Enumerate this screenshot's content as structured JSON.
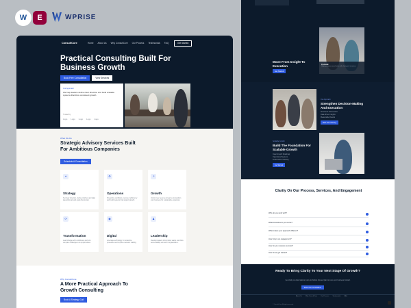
{
  "brand": {
    "logo_text": "WPRISE",
    "badge_wp": "W",
    "badge_el": "E"
  },
  "left": {
    "nav": {
      "brand": "ConsultCore",
      "items": [
        "Home",
        "About Us",
        "Why ConsultCore",
        "Our Process",
        "Testimonials",
        "FAQ"
      ],
      "cta": "Get Started"
    },
    "hero": {
      "title": "Practical Consulting Built For Business Growth",
      "subtitle": "We help leaders define clear direction and build scalable systems that drive consistent growth.",
      "btn_primary": "Book Free Consultation",
      "btn_secondary": "View Services",
      "card_label": "Our Approach",
      "card_text": "We help leaders define clear direction and build scalable systems that drive consistent growth.",
      "trusted": "Trusted by",
      "logos": [
        "Logo",
        "Logo",
        "Logo",
        "Logo",
        "Logo"
      ]
    },
    "services": {
      "eyebrow": "What We Do",
      "title": "Strategic Advisory Services Built For Ambitious Companies",
      "cta": "Schedule A Consultation",
      "cards": [
        {
          "title": "Strategy",
          "desc": "Set clear direction, define priorities and align leadership around goals that matter."
        },
        {
          "title": "Operations",
          "desc": "Streamline workflows, remove inefficiency and build systems that support growth."
        },
        {
          "title": "Growth",
          "desc": "Unlock new revenue streams and position your business for sustainable expansion."
        },
        {
          "title": "Transformation",
          "desc": "Lead change with confidence and turn complex challenges into opportunities."
        },
        {
          "title": "Digital",
          "desc": "Leverage technology to modernize processes and improve decision making."
        },
        {
          "title": "Leadership",
          "desc": "Develop leaders who inspire teams and drive accountability across the organization."
        }
      ]
    },
    "approach": {
      "eyebrow": "Why ConsultCore",
      "title": "A More Practical Approach To Growth Consulting",
      "cta": "Book A Strategy Call"
    }
  },
  "right": {
    "block1": {
      "title": "Move From Insight To Execution",
      "cta": "Get Started"
    },
    "caption": {
      "title": "Consult",
      "text": "Helping teams move faster with clarity and structure."
    },
    "block2": {
      "eyebrow": "Our Approach",
      "title": "Strengthen Decision-Making And Execution",
      "points": [
        "Structured Frameworks",
        "Data-Driven Insights",
        "Measurable Results"
      ],
      "cta": "Start Your Journey"
    },
    "block3": {
      "eyebrow": "Scalable Growth",
      "title": "Build The Foundation For Scalable Growth",
      "points": [
        "Clear Growth Roadmap",
        "Operational Systems",
        "Performance Tracking"
      ],
      "cta": "Get Started"
    },
    "faq": {
      "title": "Clarity On Our Process, Services, And Engagement",
      "questions": [
        "Who do you work with?",
        "What industries do you serve?",
        "What makes your approach different?",
        "How long is an engagement?",
        "How do you measure success?",
        "How do we get started?"
      ]
    },
    "cta": {
      "title": "Ready To Bring Clarity To Your Next Stage Of Growth?",
      "text": "Get clarity on what matters most and build a focused plan to move your business forward.",
      "btn": "Book Your Consultation",
      "footer_links": [
        "About Us",
        "Why ConsultCore",
        "Our Process",
        "Testimonials",
        "FAQ"
      ],
      "copyright": "© ConsultCore. All rights reserved."
    }
  }
}
